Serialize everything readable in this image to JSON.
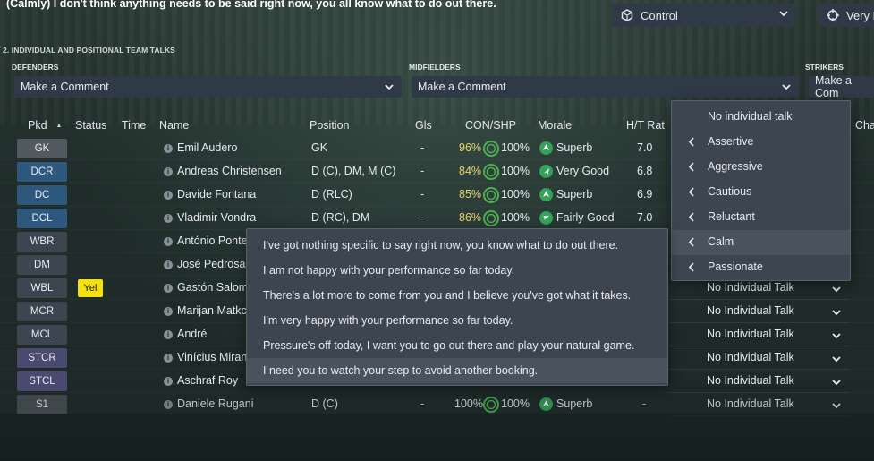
{
  "header": {
    "shout_text": "(Calmly) I don't think anything needs to be said right now, you all know what to do out there.",
    "control_label": "Control",
    "very_label": "Very F"
  },
  "section_title": "2. INDIVIDUAL AND POSITIONAL TEAM TALKS",
  "groups": {
    "defenders": "DEFENDERS",
    "midfielders": "MIDFIELDERS",
    "strikers": "STRIKERS",
    "defenders_value": "Make a Comment",
    "midfielders_value": "Make a Comment",
    "strikers_value": "Make a Com"
  },
  "columns": {
    "pkd": "Pkd",
    "status": "Status",
    "time": "Time",
    "name": "Name",
    "position": "Position",
    "gls": "Gls",
    "con_shp": "CON/SHP",
    "morale": "Morale",
    "ht_rat": "H/T Rat",
    "cha": "Cha"
  },
  "players": [
    {
      "pkd": "GK",
      "status": "",
      "name": "Emil Audero",
      "position": "GK",
      "gls": "-",
      "con": "96%",
      "shp": "100%",
      "morale": "Superb",
      "rat": "7.0",
      "talk": ""
    },
    {
      "pkd": "DCR",
      "status": "",
      "name": "Andreas Christensen",
      "position": "D (C), DM, M (C)",
      "gls": "-",
      "con": "84%",
      "shp": "100%",
      "morale": "Very Good",
      "rat": "6.8",
      "talk": ""
    },
    {
      "pkd": "DC",
      "status": "",
      "name": "Davide Fontana",
      "position": "D (RLC)",
      "gls": "-",
      "con": "85%",
      "shp": "100%",
      "morale": "Superb",
      "rat": "6.9",
      "talk": ""
    },
    {
      "pkd": "DCL",
      "status": "",
      "name": "Vladimir Vondra",
      "position": "D (RC), DM",
      "gls": "-",
      "con": "86%",
      "shp": "100%",
      "morale": "Fairly Good",
      "rat": "7.0",
      "talk": ""
    },
    {
      "pkd": "WBR",
      "status": "",
      "name": "António Ponte",
      "position": "",
      "gls": "",
      "con": "",
      "shp": "",
      "morale": "",
      "rat": "",
      "talk": ""
    },
    {
      "pkd": "DM",
      "status": "",
      "name": "José Pedrosa",
      "position": "",
      "gls": "",
      "con": "",
      "shp": "",
      "morale": "",
      "rat": "",
      "talk": ""
    },
    {
      "pkd": "WBL",
      "status": "Yel",
      "name": "Gastón Salom",
      "position": "",
      "gls": "",
      "con": "",
      "shp": "",
      "morale": "",
      "rat": "",
      "talk": "No Individual Talk"
    },
    {
      "pkd": "MCR",
      "status": "",
      "name": "Marijan Matkc",
      "position": "",
      "gls": "",
      "con": "",
      "shp": "",
      "morale": "",
      "rat": "",
      "talk": "No Individual Talk"
    },
    {
      "pkd": "MCL",
      "status": "",
      "name": "André",
      "position": "",
      "gls": "",
      "con": "",
      "shp": "",
      "morale": "",
      "rat": "",
      "talk": "No Individual Talk"
    },
    {
      "pkd": "STCR",
      "status": "",
      "name": "Vinícius Miran",
      "position": "",
      "gls": "",
      "con": "",
      "shp": "",
      "morale": "",
      "rat": "",
      "talk": "No Individual Talk"
    },
    {
      "pkd": "STCL",
      "status": "",
      "name": "Aschraf Roy",
      "position": "",
      "gls": "",
      "con": "",
      "shp": "",
      "morale": "",
      "rat": "",
      "talk": "No Individual Talk"
    },
    {
      "pkd": "S1",
      "status": "",
      "name": "Daniele Rugani",
      "position": "D (C)",
      "gls": "-",
      "con": "",
      "shp": "100%",
      "morale": "Superb",
      "rat": "",
      "sub_dash": "-",
      "talk": "No Individual Talk"
    }
  ],
  "tone_menu": {
    "none": "No individual talk",
    "items": [
      "Assertive",
      "Aggressive",
      "Cautious",
      "Reluctant",
      "Calm",
      "Passionate"
    ],
    "selected": "Calm"
  },
  "comment_menu": {
    "items": [
      "I've got nothing specific to say right now, you know what to do out there.",
      "I am not happy with your performance so far today.",
      "There's a lot more to come from you and I believe you've got what it takes.",
      "I'm very happy with your performance so far today.",
      "Pressure's off today, I want you to go out there and play your natural game.",
      "I need you to watch your step to avoid another booking."
    ],
    "selected_index": 5
  },
  "colors": {
    "yellow_card": "#f2e010",
    "morale_green": "#34a35a",
    "condition_ring": "#4caf50",
    "defender_badge": "#2e587e",
    "striker_badge": "#4a4a70"
  }
}
